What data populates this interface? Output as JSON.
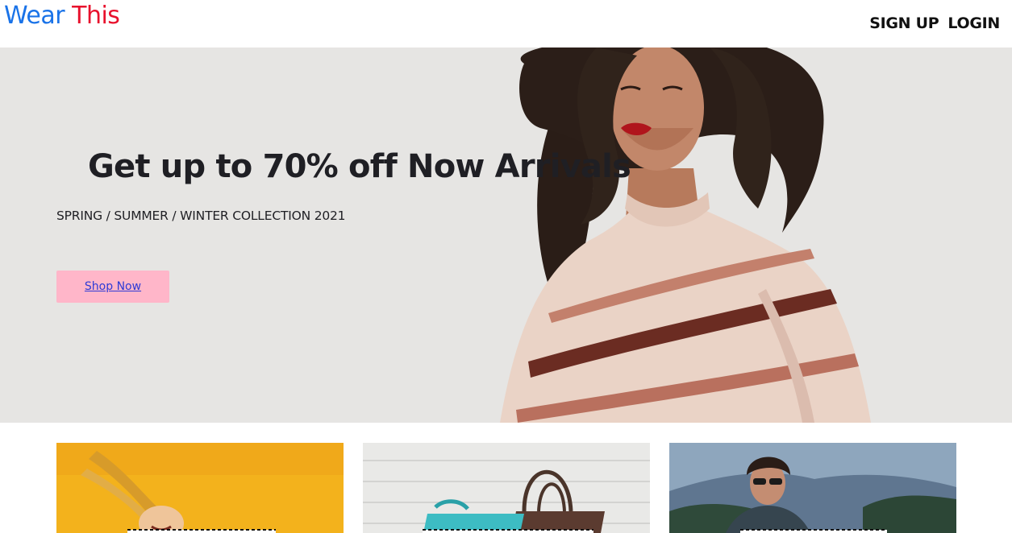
{
  "header": {
    "logo_part1": "Wear ",
    "logo_part2": "This",
    "logo_color1": "#1a73e8",
    "logo_color2": "#e8112d",
    "nav": {
      "signup_label": "SIGN UP",
      "login_label": "LOGIN"
    }
  },
  "hero": {
    "title": "Get up to 70% off Now Arrivals",
    "subtitle": "SPRING / SUMMER / WINTER COLLECTION 2021",
    "cta_label": "Shop Now",
    "cta_bg": "#ffb6c9",
    "bg_color": "#e6e5e3",
    "image": "model-in-striped-sweater"
  },
  "categories": [
    {
      "image": "woman-hair-flying-yellow-background",
      "bg_color": "#f3b21c"
    },
    {
      "image": "handbags-on-white-wood",
      "bg_color": "#e9e9e7"
    },
    {
      "image": "man-sunglasses-leather-jacket-mountains",
      "bg_color": "#6f89a4"
    }
  ]
}
